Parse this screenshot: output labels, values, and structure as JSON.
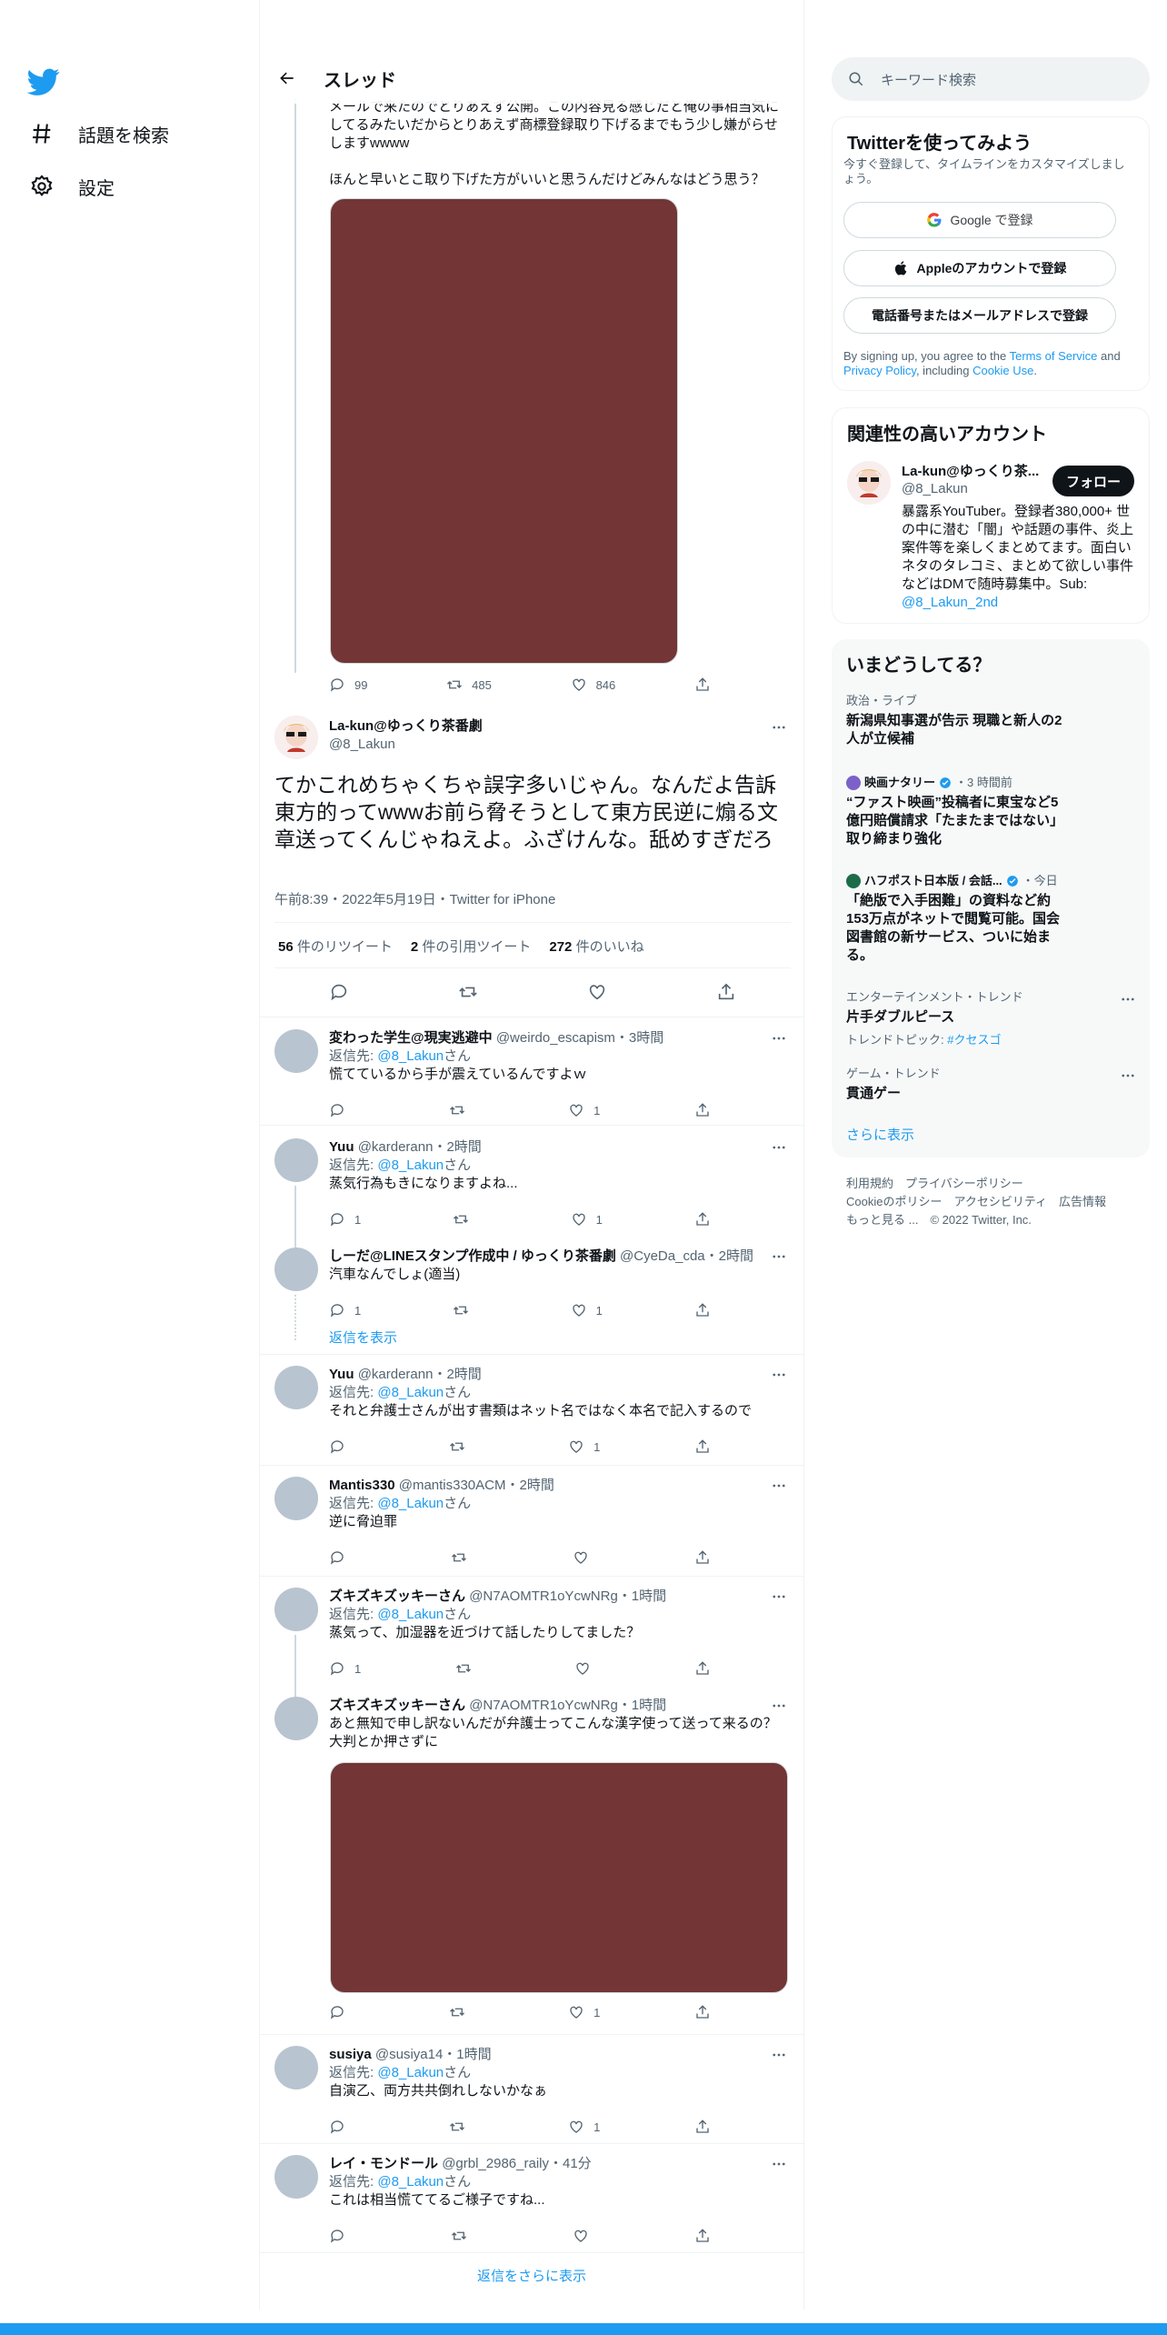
{
  "nav": {
    "explore": "話題を検索",
    "settings": "設定"
  },
  "header": {
    "title": "スレッド"
  },
  "parent_tweet": {
    "text": "メールで来たのでとりあえず公開。この内容見る感じだと俺の事相当気に\nしてるみたいだからとりあえず商標登録取り下げるまでもう少し嫌がらせ\nしますwwww\n\nほんと早いとこ取り下げた方がいいと思うんだけどみんなはどう思う？",
    "replies": "99",
    "retweets": "485",
    "likes": "846"
  },
  "main_tweet": {
    "name": "La-kun@ゆっくり茶番劇",
    "handle": "@8_Lakun",
    "text": "てかこれめちゃくちゃ誤字多いじゃん。なんだよ告訴東方的ってwwwお前ら脅そうとして東方民逆に煽る文章送ってくんじゃねえよ。ふざけんな。舐めすぎだろ",
    "meta": "午前8:39・2022年5月19日・Twitter for iPhone",
    "retweets_num": "56",
    "retweets_label": " 件のリツイート",
    "quotes_num": "2",
    "quotes_label": " 件の引用ツイート",
    "likes_num": "272",
    "likes_label": " 件のいいね"
  },
  "reply_to_prefix": "返信先: ",
  "reply_to_handle": "@8_Lakun",
  "reply_to_suffix": "さん",
  "replies": [
    {
      "name": "変わった学生@現実逃避中",
      "handle": "@weirdo_escapism・3時間",
      "text": "慌てているから手が震えているんですよｗ",
      "replies": "",
      "retweets": "",
      "likes": "1"
    },
    {
      "name": "Yuu",
      "handle": "@karderann・2時間",
      "text": "蒸気行為もきになりますよね...",
      "replies": "1",
      "retweets": "",
      "likes": "1"
    },
    {
      "name": "しーだ@LINEスタンプ作成中 / ゆっくり茶番劇",
      "handle": "@CyeDa_cda・2時間",
      "text": "汽車なんでしょ(適当)",
      "replies": "1",
      "retweets": "",
      "likes": "1"
    },
    {
      "name": "Yuu",
      "handle": "@karderann・2時間",
      "text": "それと弁護士さんが出す書類はネット名ではなく本名で記入するので",
      "replies": "",
      "retweets": "",
      "likes": "1"
    },
    {
      "name": "Mantis330",
      "handle": "@mantis330ACM・2時間",
      "text": "逆に脅迫罪",
      "replies": "",
      "retweets": "",
      "likes": ""
    },
    {
      "name": "ズキズキズッキーさん",
      "handle": "@N7AOMTR1oYcwNRg・1時間",
      "text": "蒸気って、加湿器を近づけて話したりしてました？",
      "replies": "1",
      "retweets": "",
      "likes": ""
    },
    {
      "name": "ズキズキズッキーさん",
      "handle": "@N7AOMTR1oYcwNRg・1時間",
      "text": "あと無知で申し訳ないんだが弁護士ってこんな漢字使って送って来るの？\n大判とか押さずに",
      "replies": "",
      "retweets": "",
      "likes": "1"
    },
    {
      "name": "susiya",
      "handle": "@susiya14・1時間",
      "text": "自演乙、両方共共倒れしないかなぁ",
      "replies": "",
      "retweets": "",
      "likes": "1"
    },
    {
      "name": "レイ・モンドール",
      "handle": "@grbl_2986_raily・41分",
      "text": "これは相当慌ててるご様子ですね...",
      "replies": "",
      "retweets": "",
      "likes": ""
    }
  ],
  "show_replies": "返信を表示",
  "more_replies": "返信をさらに表示",
  "right": {
    "search_placeholder": "キーワード検索",
    "signup": {
      "title": "Twitterを使ってみよう",
      "sub": "今すぐ登録して、タイムラインをカスタマイズしましょう。",
      "google": "Google で登録",
      "apple": "Appleのアカウントで登録",
      "phone": "電話番号またはメールアドレスで登録",
      "legal_1": "By signing up, you agree to the ",
      "terms": "Terms of Service",
      "legal_2": " and ",
      "privacy": "Privacy Policy",
      "legal_3": ", including ",
      "cookie": "Cookie Use",
      "legal_4": "."
    },
    "related": {
      "title": "関連性の高いアカウント",
      "name": "La-kun@ゆっくり茶...",
      "handle": "@8_Lakun",
      "follow": "フォロー",
      "bio": "暴露系YouTuber。登録者380,000+ 世の中に潜む「闇」や話題の事件、炎上案件等を楽しくまとめてます。面白いネタのタレコミ、まとめて欲しい事件などはDMで随時募集中。Sub:",
      "bio_link": "@8_Lakun_2nd"
    },
    "trends": {
      "title": "いまどうしてる？",
      "t1_meta": "政治・ライブ",
      "t1_title": "新潟県知事選が告示 現職と新人の2人が立候補",
      "t2_source": "映画ナタリー",
      "t2_time": "・3 時間前",
      "t2_title": "“ファスト映画”投稿者に東宝など5億円賠償請求「たまたまではない」取り締まり強化",
      "t3_source": "ハフポスト日本版 / 会話...",
      "t3_time": "・今日",
      "t3_title": "「絶版で入手困難」の資料など約153万点がネットで閲覧可能。国会図書館の新サービス、ついに始まる。",
      "t4_meta": "エンターテインメント・トレンド",
      "t4_title": "片手ダブルピース",
      "t4_sub": "トレンドトピック: ",
      "t4_tag": "#クセスゴ",
      "t5_meta": "ゲーム・トレンド",
      "t5_title": "貫通ゲー",
      "show_more": "さらに表示"
    },
    "footer": {
      "l1": "利用規約　プライバシーポリシー",
      "l2": "Cookieのポリシー　アクセシビリティ　広告情報",
      "l3": "もっと見る ...　© 2022 Twitter, Inc."
    }
  },
  "colors": {
    "accent": "#1d9bf0",
    "media": "#733535",
    "avatar": "#b8c4cf"
  }
}
